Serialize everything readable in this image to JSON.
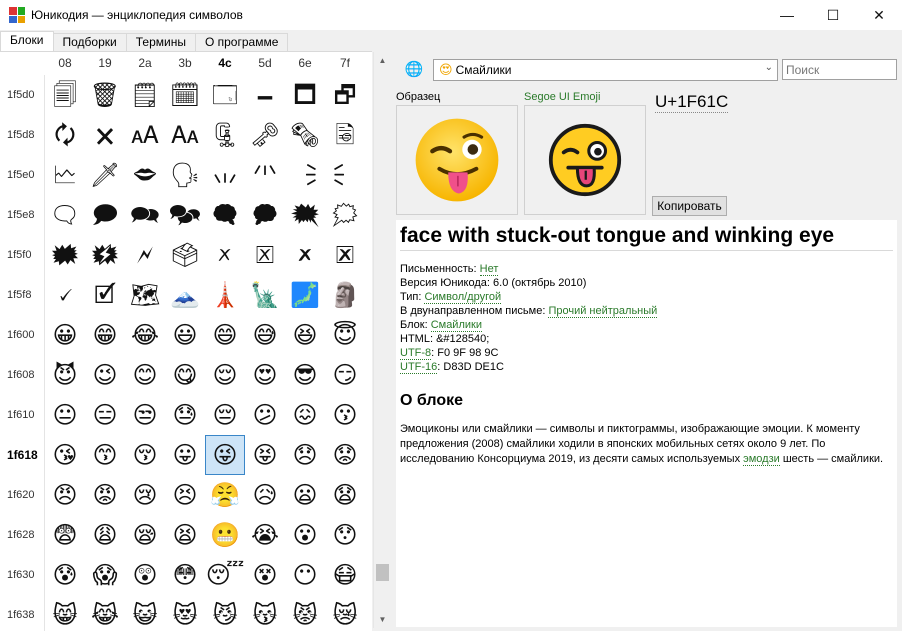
{
  "window": {
    "title": "Юникодия — энциклопедия символов",
    "minimize_glyph": "—",
    "maximize_glyph": "☐",
    "close_glyph": "✕"
  },
  "tabs": [
    {
      "label": "Блоки",
      "active": true
    },
    {
      "label": "Подборки",
      "active": false
    },
    {
      "label": "Термины",
      "active": false
    },
    {
      "label": "О программе",
      "active": false
    }
  ],
  "grid": {
    "columns": [
      "08",
      "19",
      "2a",
      "3b",
      "4c",
      "5d",
      "6e",
      "7f"
    ],
    "selected_column": "4c",
    "selected_row": "1f618",
    "rows": [
      {
        "label": "1f5d0",
        "cells": [
          "🗐",
          "🗑",
          "🗒",
          "🗓",
          "🗔",
          "🗕",
          "🗖",
          "🗗"
        ]
      },
      {
        "label": "1f5d8",
        "cells": [
          "🗘",
          "🗙",
          "🗚",
          "🗛",
          "🗜",
          "🗝",
          "🗞",
          "🗟"
        ]
      },
      {
        "label": "1f5e0",
        "cells": [
          "🗠",
          "🗡",
          "🗢",
          "🗣",
          "🗤",
          "🗥",
          "🗦",
          "🗧"
        ]
      },
      {
        "label": "1f5e8",
        "cells": [
          "🗨",
          "🗩",
          "🗪",
          "🗫",
          "🗬",
          "🗭",
          "🗮",
          "🗯"
        ]
      },
      {
        "label": "1f5f0",
        "cells": [
          "🗰",
          "🗱",
          "🗲",
          "🗳",
          "🗴",
          "🗵",
          "🗶",
          "🗷"
        ]
      },
      {
        "label": "1f5f8",
        "cells": [
          "🗸",
          "🗹",
          "🗺",
          "🗻",
          "🗼",
          "🗽",
          "🗾",
          "🗿"
        ]
      },
      {
        "label": "1f600",
        "cells": [
          "😀",
          "😁",
          "😂",
          "😃",
          "😄",
          "😅",
          "😆",
          "😇"
        ]
      },
      {
        "label": "1f608",
        "cells": [
          "😈",
          "😉",
          "😊",
          "😋",
          "😌",
          "😍",
          "😎",
          "😏"
        ]
      },
      {
        "label": "1f610",
        "cells": [
          "😐",
          "😑",
          "😒",
          "😓",
          "😔",
          "😕",
          "😖",
          "😗"
        ]
      },
      {
        "label": "1f618",
        "cells": [
          "😘",
          "😙",
          "😚",
          "😛",
          "😜",
          "😝",
          "😞",
          "😟"
        ]
      },
      {
        "label": "1f620",
        "cells": [
          "😠",
          "😡",
          "😢",
          "😣",
          "😤",
          "😥",
          "😦",
          "😧"
        ]
      },
      {
        "label": "1f628",
        "cells": [
          "😨",
          "😩",
          "😪",
          "😫",
          "😬",
          "😭",
          "😮",
          "😯"
        ]
      },
      {
        "label": "1f630",
        "cells": [
          "😰",
          "😱",
          "😲",
          "😳",
          "😴",
          "😵",
          "😶",
          "😷"
        ]
      },
      {
        "label": "1f638",
        "cells": [
          "😸",
          "😹",
          "😺",
          "😻",
          "😼",
          "😽",
          "😾",
          "😿"
        ]
      }
    ]
  },
  "toolbar": {
    "block_select_icon": "😍",
    "block_select_value": "Смайлики",
    "search_placeholder": "Поиск"
  },
  "preview": {
    "sample_label": "Образец",
    "font_label": "Segoe UI Emoji",
    "codepoint": "U+1F61C",
    "copy_button": "Копировать"
  },
  "info": {
    "char_name": "face with stuck-out tongue and winking eye",
    "props": {
      "script_label": "Письменность: ",
      "script_value": "Нет",
      "version_label": "Версия Юникода: ",
      "version_value": "6.0 (октябрь 2010)",
      "type_label": "Тип: ",
      "type_value": "Символ/другой",
      "bidi_label": "В двунаправленном письме: ",
      "bidi_value": "Прочий нейтральный",
      "block_label": "Блок: ",
      "block_value": "Смайлики",
      "html_label": "HTML: ",
      "html_value": "&#128540;",
      "utf8_label": "UTF-8",
      "utf8_value": ": F0 9F 98 9C",
      "utf16_label": "UTF-16",
      "utf16_value": ": D83D DE1C"
    },
    "about_heading": "О блоке",
    "about_text_1": "Эмоциконы или смайлики — символы и пиктограммы, изображающие эмоции. К моменту предложения (2008) смайлики ходили в японских мобильных сетях около 9 лет. По исследованию Консорциума 2019, из десяти самых используемых ",
    "about_link": "эмодзи",
    "about_text_2": " шесть — смайлики."
  },
  "colors": {
    "link": "#2a7a2a",
    "selection_border": "#3a86c8",
    "selection_fill": "#cde4f7",
    "emoji_yellow": "#ffcc22",
    "tongue": "#e8457a"
  },
  "icons": {
    "app": "app-logo-icon",
    "globe": "globe-icon",
    "dropdown": "chevron-down-icon"
  }
}
